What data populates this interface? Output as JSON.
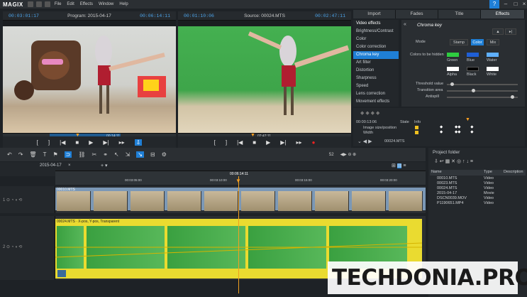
{
  "app": {
    "logo": "MAGIX"
  },
  "menu": [
    "File",
    "Edit",
    "Effects",
    "Window",
    "Help"
  ],
  "program_monitor": {
    "timecode_left": "00:03:01:17",
    "title": "Program: 2015-04-17",
    "timecode_right": "00:06:14:11",
    "ruler_label": "00:14:11"
  },
  "source_monitor": {
    "timecode_left": "00:01:10:06",
    "title": "Source: 00024.MTS",
    "timecode_right": "00:02:47:11",
    "ruler_label": "02:47:11"
  },
  "tabs": [
    "Import",
    "Fades",
    "Title",
    "Effects"
  ],
  "active_tab": "Effects",
  "video_effects": {
    "header": "Video effects",
    "items": [
      "Brightness/Contrast",
      "Color",
      "Color correction",
      "Chroma key",
      "Art filter",
      "Distortion",
      "Sharpness",
      "Speed",
      "Lens correction",
      "Movement effects"
    ],
    "selected": "Chroma key"
  },
  "chroma": {
    "title": "Chroma key",
    "mode_label": "Mode",
    "modes": [
      "Stamp",
      "Color",
      "Mix"
    ],
    "active_mode": "Color",
    "hide_label": "Colors to be hidden",
    "colors": [
      {
        "name": "Green",
        "hex": "#2ecc40"
      },
      {
        "name": "Blue",
        "hex": "#1f5fd6"
      },
      {
        "name": "Water",
        "hex": "#5fb0ff"
      },
      {
        "name": "Alpha",
        "hex": "#ffffff"
      },
      {
        "name": "Black",
        "hex": "#000000"
      },
      {
        "name": "White",
        "hex": "#ffffff"
      }
    ],
    "threshold_label": "Threshold value",
    "threshold": 0.05,
    "transition_label": "Transition area",
    "transition": 0.35,
    "antispill_label": "Antispill",
    "antispill": 0.9
  },
  "keyframes": {
    "time": "00:00:13:06",
    "col_state": "State",
    "col_info": "Info",
    "rows": [
      "Image size/position",
      "Width"
    ],
    "nav_label": "00024.MTS"
  },
  "timeline": {
    "project_tab": "2015-04-17",
    "ruler_center": "00:06:14:11",
    "ruler_marks": [
      "00:03:05:00",
      "00:03:10:00",
      "00:03:15:00",
      "00:03:20:00"
    ],
    "track1_clip": "00010.MTS",
    "track2_clip": "00024.MTS · X-pos, Y-pos, Transparent",
    "zoom_label": "52"
  },
  "project_folder": {
    "title": "Project folder",
    "columns": [
      "Name",
      "Type",
      "Description"
    ],
    "files": [
      {
        "name": "00010.MTS",
        "type": "Video"
      },
      {
        "name": "00023.MTS",
        "type": "Video"
      },
      {
        "name": "00024.MTS",
        "type": "Video"
      },
      {
        "name": "2015-04-17",
        "type": "Movie"
      },
      {
        "name": "DSCN0039.MOV",
        "type": "Video"
      },
      {
        "name": "P1190651.MP4",
        "type": "Video"
      }
    ]
  },
  "watermark": "TECHDONIA.PRO",
  "colors": {
    "accent": "#1f7fd6",
    "timecode": "#4da3e8",
    "clip_yellow": "#eadb30",
    "playhead": "#f0a020"
  }
}
